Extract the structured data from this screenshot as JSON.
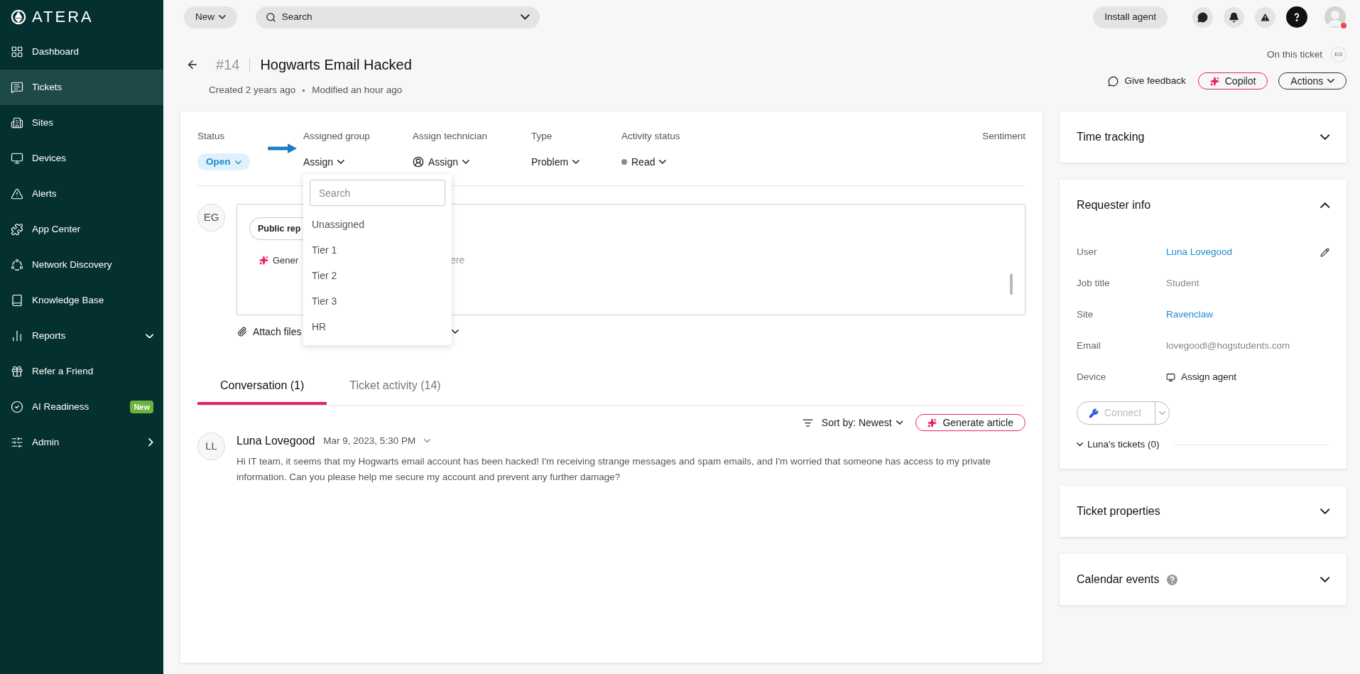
{
  "sidebar": {
    "logo": "ATERA",
    "items": [
      {
        "label": "Dashboard",
        "selected": false,
        "kind": "plain"
      },
      {
        "label": "Tickets",
        "selected": true,
        "kind": "plain"
      },
      {
        "label": "Sites",
        "selected": false,
        "kind": "plain"
      },
      {
        "label": "Devices",
        "selected": false,
        "kind": "plain"
      },
      {
        "label": "Alerts",
        "selected": false,
        "kind": "plain"
      },
      {
        "label": "App Center",
        "selected": false,
        "kind": "plain"
      },
      {
        "label": "Network Discovery",
        "selected": false,
        "kind": "plain"
      },
      {
        "label": "Knowledge Base",
        "selected": false,
        "kind": "plain"
      },
      {
        "label": "Reports",
        "selected": false,
        "kind": "collapsible"
      },
      {
        "label": "Refer a Friend",
        "selected": false,
        "kind": "plain"
      },
      {
        "label": "AI Readiness",
        "selected": false,
        "kind": "plain",
        "badge": "New"
      },
      {
        "label": "Admin",
        "selected": false,
        "kind": "submenu"
      }
    ]
  },
  "topbar": {
    "new_button": "New",
    "search": {
      "placeholder": "Search"
    },
    "install_button": "Install agent",
    "avatar_alert": true
  },
  "ticket": {
    "number": "#14",
    "title": "Hogwarts Email Hacked",
    "created": "Created 2 years ago",
    "modified": "Modified an hour ago",
    "on_this_ticket": "On this ticket",
    "viewer": "EG",
    "feedback": "Give feedback",
    "copilot": "Copilot",
    "actions": "Actions"
  },
  "fields": [
    {
      "label": "Status",
      "value": "Open",
      "kind": "pill"
    },
    {
      "label": "Assigned group",
      "value": "Assign",
      "kind": "plain"
    },
    {
      "label": "Assign technician",
      "value": "Assign",
      "kind": "person"
    },
    {
      "label": "Type",
      "value": "Problem",
      "kind": "plain"
    },
    {
      "label": "Activity status",
      "value": "Read",
      "kind": "dot"
    },
    {
      "label": "Sentiment",
      "kind": "empty"
    }
  ],
  "group_dropdown": {
    "open": true,
    "search_placeholder": "Search",
    "options": [
      "Unassigned",
      "Tier 1",
      "Tier 2",
      "Tier 3",
      "HR"
    ]
  },
  "composer": {
    "author": "EG",
    "reply_button": "Public rep",
    "generate": "Gener",
    "placeholder_fragment": "ere",
    "attach": "Attach files"
  },
  "tabs": [
    {
      "label": "Conversation (1)",
      "selected": true
    },
    {
      "label": "Ticket activity (14)",
      "selected": false
    }
  ],
  "sort": "Sort by: Newest",
  "generate_article": "Generate article",
  "messages": [
    {
      "initials": "LL",
      "author": "Luna Lovegood",
      "date": "Mar 9, 2023, 5:30 PM",
      "body": "Hi IT team, it seems that my Hogwarts email account has been hacked! I'm receiving strange messages and spam emails, and I'm worried that someone has access to my private information. Can you please help me secure my account and prevent any further damage?"
    }
  ],
  "panels": [
    {
      "title": "Time tracking",
      "expanded": false
    },
    {
      "title": "Requester info",
      "expanded": true,
      "rows": [
        {
          "label": "User",
          "value": "Luna Lovegood",
          "kind": "link",
          "editable": true
        },
        {
          "label": "Job title",
          "value": "Student",
          "kind": "text",
          "editable": false
        },
        {
          "label": "Site",
          "value": "Ravenclaw",
          "kind": "link",
          "editable": false
        },
        {
          "label": "Email",
          "value": "lovegoodl@hogstudents.com",
          "kind": "text",
          "editable": false
        },
        {
          "label": "Device",
          "value": "Assign agent",
          "kind": "device",
          "editable": false
        }
      ],
      "connect": {
        "label": "Connect",
        "disabled": true
      },
      "tickets": "Luna's tickets (0)"
    },
    {
      "title": "Ticket properties",
      "expanded": false
    },
    {
      "title": "Calendar events",
      "expanded": false,
      "help": true
    }
  ]
}
